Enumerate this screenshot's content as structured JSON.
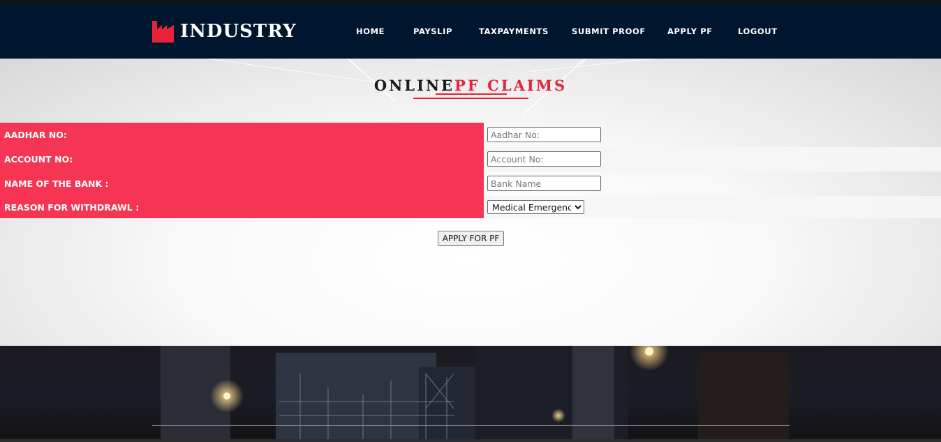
{
  "brand": {
    "name": "INDUSTRY",
    "logo_icon": "factory-icon",
    "accent_color": "#e8223a"
  },
  "nav": {
    "items": [
      {
        "label": "HOME"
      },
      {
        "label": "PAYSLIP"
      },
      {
        "label": "TAXPAYMENTS"
      },
      {
        "label": "SUBMIT PROOF"
      },
      {
        "label": "APPLY PF"
      },
      {
        "label": "LOGOUT"
      }
    ]
  },
  "page": {
    "title_part1": "ONLINE",
    "title_part2": "PF CLAIMS"
  },
  "form": {
    "aadhar": {
      "label": "AADHAR NO:",
      "placeholder": "Aadhar No:",
      "value": ""
    },
    "account": {
      "label": "ACCOUNT NO:",
      "placeholder": "Account No:",
      "value": ""
    },
    "bank": {
      "label": "NAME OF THE BANK :",
      "placeholder": "Bank Name",
      "value": ""
    },
    "reason": {
      "label": "REASON FOR WITHDRAWL :",
      "selected": "Medical Emergency"
    },
    "submit_label": "APPLY FOR PF",
    "label_bg_color": "#f53553"
  },
  "colors": {
    "header_bg": "#00152e"
  }
}
